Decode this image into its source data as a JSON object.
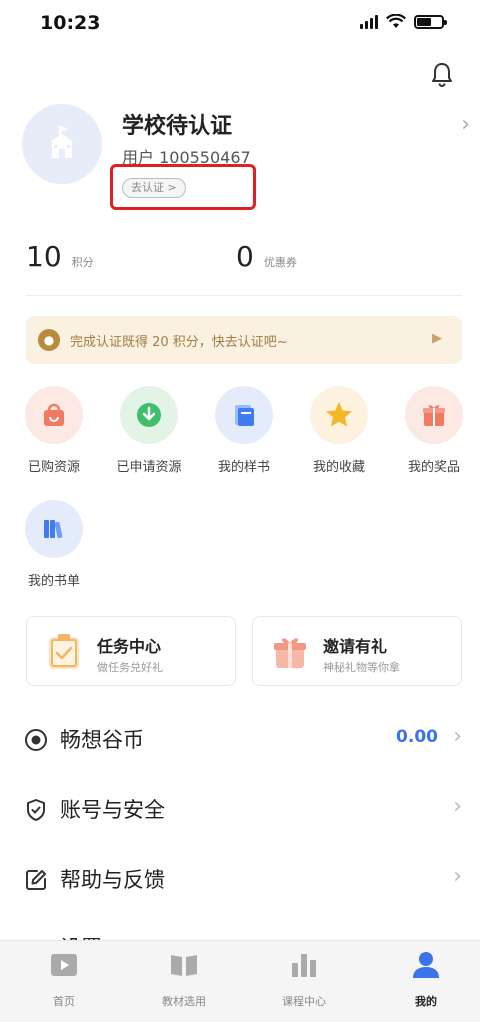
{
  "status_bar": {
    "time": "10:23"
  },
  "profile": {
    "title": "学校待认证",
    "user_id": "用户 100550467",
    "verify_label": "去认证 >"
  },
  "stats": [
    {
      "value": "10",
      "label": "积分"
    },
    {
      "value": "0",
      "label": "优惠券"
    }
  ],
  "promo": {
    "text": "完成认证既得 20 积分，快去认证吧~"
  },
  "grid": [
    {
      "label": "已购资源",
      "icon": "shopping-bag-icon",
      "bg": "#fde9e4",
      "color": "#f07a62"
    },
    {
      "label": "已申请资源",
      "icon": "download-icon",
      "bg": "#e3f4e7",
      "color": "#3fbf6a"
    },
    {
      "label": "我的样书",
      "icon": "book-stack-icon",
      "bg": "#e4ecfb",
      "color": "#3f7cf0"
    },
    {
      "label": "我的收藏",
      "icon": "star-icon",
      "bg": "#fdf2e0",
      "color": "#f5b728"
    },
    {
      "label": "我的奖品",
      "icon": "gift-icon",
      "bg": "#fde9e4",
      "color": "#f07a62"
    },
    {
      "label": "我的书单",
      "icon": "bookshelf-icon",
      "bg": "#e4ecfb",
      "color": "#3f7cf0"
    }
  ],
  "cards": [
    {
      "title": "任务中心",
      "subtitle": "做任务兑好礼",
      "icon": "clipboard-icon"
    },
    {
      "title": "邀请有礼",
      "subtitle": "神秘礼物等你拿",
      "icon": "gift-box-icon"
    }
  ],
  "menu": [
    {
      "label": "畅想谷币",
      "value": "0.00",
      "icon": "coin-icon"
    },
    {
      "label": "账号与安全",
      "value": "",
      "icon": "shield-icon"
    },
    {
      "label": "帮助与反馈",
      "value": "",
      "icon": "edit-icon"
    },
    {
      "label": "设置",
      "value": "",
      "icon": "settings-icon"
    }
  ],
  "tabbar": [
    {
      "label": "首页",
      "icon": "play-icon",
      "active": false
    },
    {
      "label": "教材选用",
      "icon": "open-book-icon",
      "active": false
    },
    {
      "label": "课程中心",
      "icon": "bar-chart-icon",
      "active": false
    },
    {
      "label": "我的",
      "icon": "user-icon",
      "active": true
    }
  ],
  "colors": {
    "accent": "#3b74e8",
    "highlight": "#e02020",
    "promo_bg": "#fbf1e0"
  }
}
